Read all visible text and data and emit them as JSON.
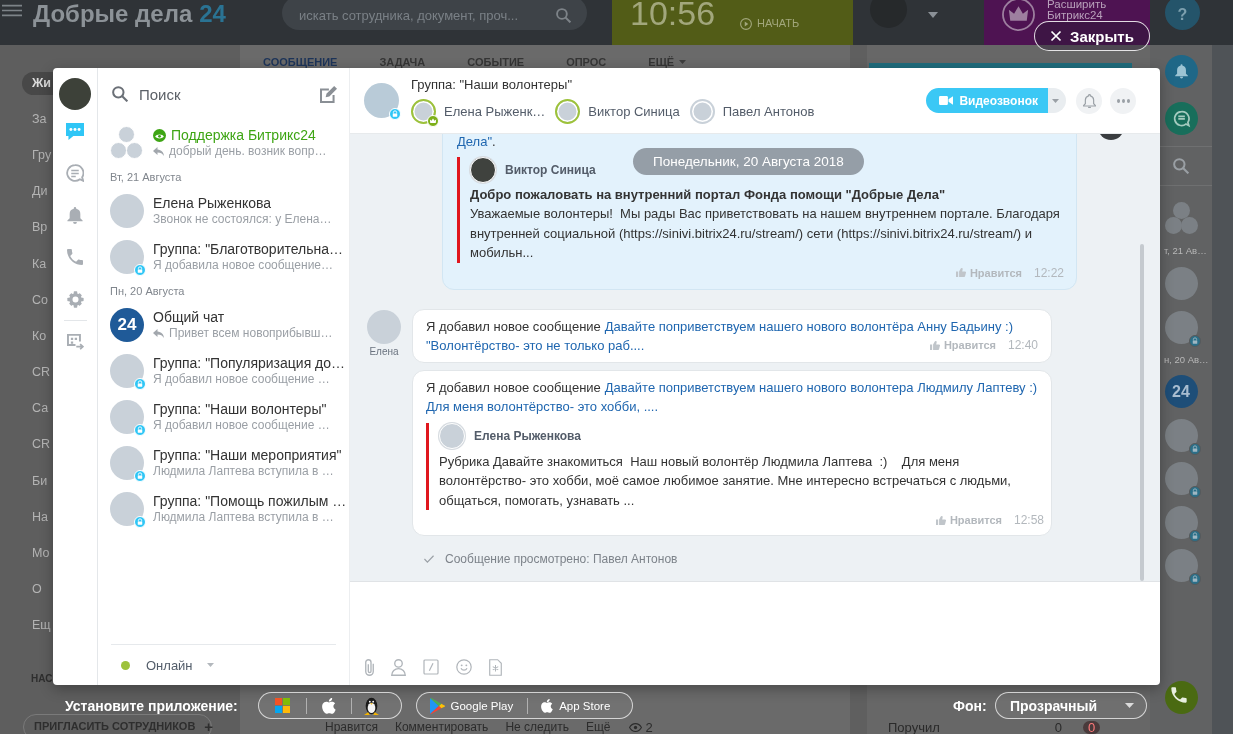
{
  "portal": {
    "logo": {
      "name": "Добрые дела",
      "number": "24"
    },
    "search": {
      "placeholder": "искать сотрудника, документ, проч..."
    },
    "timer": {
      "time": "10:56",
      "action": "НАЧАТЬ"
    },
    "upgrade": {
      "lines": [
        "Расширить",
        "Битрикс24"
      ]
    },
    "help": "?",
    "composer_tabs": [
      {
        "label": "СООБЩЕНИЕ",
        "selected": true,
        "menu": false
      },
      {
        "label": "ЗАДАЧА",
        "selected": false,
        "menu": false
      },
      {
        "label": "СОБЫТИЕ",
        "selected": false,
        "menu": false
      },
      {
        "label": "ОПРОС",
        "selected": false,
        "menu": false
      },
      {
        "label": "ЕЩЁ",
        "selected": false,
        "menu": true
      }
    ],
    "menu": [
      {
        "label": "Жи",
        "selected": true
      },
      {
        "label": "За",
        "selected": false
      },
      {
        "label": "Гру",
        "selected": false
      },
      {
        "label": "Ди",
        "selected": false
      },
      {
        "label": "Вр",
        "selected": false
      },
      {
        "label": "Ка",
        "selected": false
      },
      {
        "label": "Со",
        "selected": false
      },
      {
        "label": "Ко",
        "selected": false
      },
      {
        "label": "CR",
        "selected": false
      },
      {
        "label": "Са",
        "selected": false
      },
      {
        "label": "CR",
        "selected": false
      },
      {
        "label": "Би",
        "selected": false
      },
      {
        "label": "На",
        "selected": false
      },
      {
        "label": "Мо",
        "selected": false
      },
      {
        "label": "О",
        "selected": false
      },
      {
        "label": "Ещ",
        "selected": false
      }
    ],
    "menu_settings": "НАС",
    "invite": {
      "label": "ПРИГЛАСИТЬ СОТРУДНИКОВ",
      "icon": "+"
    },
    "post_actions": [
      "Нравится",
      "Комментировать",
      "Не следить",
      "Ещё"
    ],
    "views": "2",
    "task": {
      "label": "Поручил",
      "count": "0",
      "overdue": "0"
    },
    "strip": [
      {
        "kind": "notifications"
      },
      {
        "kind": "open-lines"
      },
      {
        "kind": "search"
      },
      {
        "kind": "support"
      },
      {
        "kind": "date",
        "label": "т, 21 Ав…"
      },
      {
        "kind": "avatar",
        "locked": false
      },
      {
        "kind": "avatar",
        "locked": true
      },
      {
        "kind": "date",
        "label": "н, 20 Ав…"
      },
      {
        "kind": "general",
        "label": "24"
      },
      {
        "kind": "avatar",
        "locked": true
      },
      {
        "kind": "avatar",
        "locked": true
      },
      {
        "kind": "avatar",
        "locked": true
      },
      {
        "kind": "avatar",
        "locked": true
      },
      {
        "kind": "call"
      }
    ]
  },
  "messenger": {
    "rail": [
      {
        "kind": "chats",
        "selected": true
      },
      {
        "kind": "open-lines",
        "selected": false
      },
      {
        "kind": "notifications",
        "selected": false
      },
      {
        "kind": "calls",
        "selected": false
      },
      {
        "kind": "settings",
        "selected": false
      },
      {
        "kind": "tasks",
        "selected": false
      }
    ],
    "search": {
      "placeholder": "Поиск"
    },
    "recent": [
      {
        "kind": "support",
        "title": "Поддержка Битрикс24",
        "preview": "добрый день. возник вопр…",
        "reply": true,
        "locked": false
      },
      {
        "kind": "date",
        "label": "Вт, 21 Августа"
      },
      {
        "kind": "user",
        "title": "Елена Рыженкова",
        "preview": "Звонок не состоялся: у Елена…",
        "reply": false,
        "locked": false
      },
      {
        "kind": "group",
        "title": "Группа: \"Благотворительна…",
        "preview": "Я добавила новое сообщение…",
        "reply": false,
        "locked": true
      },
      {
        "kind": "date",
        "label": "Пн, 20 Августа"
      },
      {
        "kind": "general",
        "avatar_text": "24",
        "title": "Общий чат",
        "preview": "Привет всем новоприбывш…",
        "reply": true,
        "locked": false
      },
      {
        "kind": "group",
        "title": "Группа: \"Популяризация до…",
        "preview": "Я добавил новое сообщение …",
        "reply": false,
        "locked": true
      },
      {
        "kind": "group",
        "title": "Группа: \"Наши волонтеры\"",
        "preview": "Я добавил новое сообщение …",
        "reply": false,
        "locked": true
      },
      {
        "kind": "group",
        "title": "Группа: \"Наши мероприятия\"",
        "preview": "Людмила Лаптева вступила в …",
        "reply": false,
        "locked": true
      },
      {
        "kind": "group",
        "title": "Группа: \"Помощь пожилым …",
        "preview": "Людмила Лаптева вступила в …",
        "reply": false,
        "locked": true
      }
    ],
    "status": {
      "label": "Онлайн",
      "online": true
    },
    "chat": {
      "title": "Группа: \"Наши волонтеры\"",
      "locked": true,
      "members": [
        {
          "name": "Елена Рыженк…",
          "online": true,
          "owner": true
        },
        {
          "name": "Виктор Синица",
          "online": true,
          "owner": false
        },
        {
          "name": "Павел Антонов",
          "online": false,
          "owner": false
        }
      ],
      "video_call": "Видеозвонок"
    },
    "messages": {
      "date_divider": "Понедельник, 20 Августа 2018",
      "items": [
        {
          "kind": "own",
          "link": "Дела\"",
          "text": ".",
          "quote": {
            "author": "Виктор Синица",
            "title": "Добро пожаловать на внутренний портал Фонда помощи \"Добрые Дела\"",
            "text": "Уважаемые волонтеры!  Мы рады Вас приветствовать на нашем внутреннем портале. Благодаря внутренней социальной (https://sinivi.bitrix24.ru/stream/) сети (https://sinivi.bitrix24.ru/stream/) и мобильн..."
          },
          "like": "Нравится",
          "time": "12:22"
        },
        {
          "kind": "incoming",
          "author": "Елена",
          "text": "Я добавил новое сообщение",
          "link_lines": [
            "Давайте поприветствуем нашего нового волонтёра Анну Бадьину :)",
            "\"Волонтёрство- это не только раб...."
          ],
          "like": "Нравится",
          "time": "12:40"
        },
        {
          "kind": "incoming",
          "text": "Я добавил новое сообщение",
          "link_lines": [
            "Давайте поприветствуем нашего нового волонтера Людмилу Лаптеву :)",
            "Для меня волонтёрство- это хобби, ...."
          ],
          "quote": {
            "author": "Елена Рыженкова",
            "text": "Рубрика Давайте знакомиться  Наш новый волонтёр Людмила Лаптева  :)    Для меня волонтёрство- это хобби, моё самое любимое занятие. Мне интересно встречаться с людьми, общаться, помогать, узнавать ..."
          },
          "like": "Нравится",
          "time": "12:58"
        }
      ],
      "read_receipt": "Сообщение просмотрено: Павел Антонов"
    }
  },
  "close_button": {
    "label": "Закрыть"
  },
  "app_bar": {
    "label": "Установите приложение:",
    "stores": [
      {
        "kind": "google-play",
        "label": "Google Play"
      },
      {
        "kind": "app-store",
        "label": "App Store"
      }
    ]
  },
  "background_picker": {
    "label": "Фон:",
    "value": "Прозрачный"
  }
}
